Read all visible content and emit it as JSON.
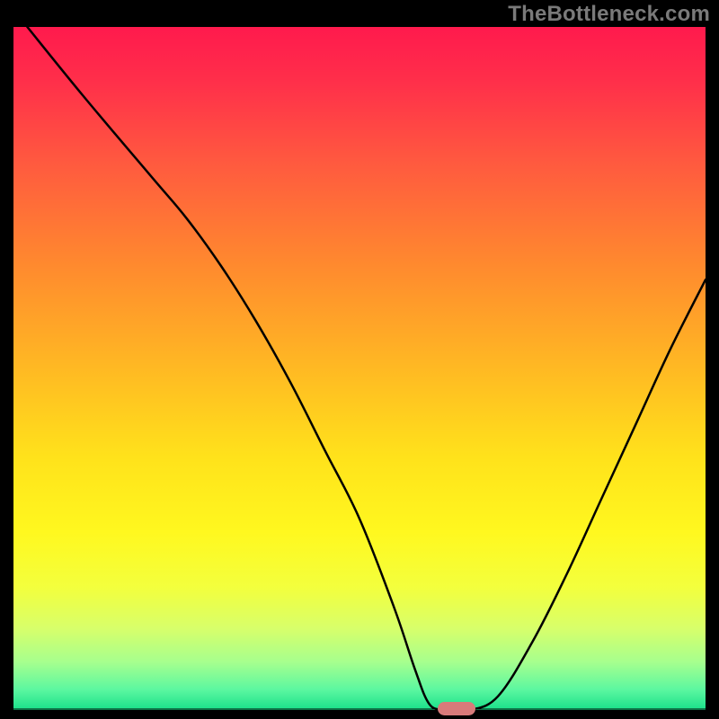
{
  "watermark": "TheBottleneck.com",
  "colors": {
    "frame": "#000000",
    "watermark": "#7a7a7a",
    "curve": "#000000",
    "marker": "#d87a7a",
    "gradient_stops": [
      {
        "offset": 0.0,
        "color": "#ff1a4d"
      },
      {
        "offset": 0.08,
        "color": "#ff2f4a"
      },
      {
        "offset": 0.2,
        "color": "#ff5a3f"
      },
      {
        "offset": 0.35,
        "color": "#ff8a2e"
      },
      {
        "offset": 0.5,
        "color": "#ffb923"
      },
      {
        "offset": 0.63,
        "color": "#ffe21b"
      },
      {
        "offset": 0.74,
        "color": "#fff81f"
      },
      {
        "offset": 0.82,
        "color": "#f3ff3d"
      },
      {
        "offset": 0.88,
        "color": "#d8ff6a"
      },
      {
        "offset": 0.93,
        "color": "#a6ff8e"
      },
      {
        "offset": 0.97,
        "color": "#5cf7a0"
      },
      {
        "offset": 1.0,
        "color": "#19e08a"
      }
    ]
  },
  "chart_data": {
    "type": "line",
    "title": "",
    "xlabel": "",
    "ylabel": "",
    "xlim": [
      0,
      100
    ],
    "ylim": [
      0,
      100
    ],
    "grid": false,
    "note": "V-shaped bottleneck curve on red→green vertical gradient. Values estimated from pixels: y=0 is bottom (optimal), y=100 is top (severe mismatch).",
    "x": [
      2,
      10,
      20,
      25,
      30,
      35,
      40,
      45,
      50,
      55,
      58,
      60,
      62,
      64,
      66,
      70,
      75,
      80,
      85,
      90,
      95,
      100
    ],
    "y": [
      100,
      90,
      78,
      72,
      65,
      57,
      48,
      38,
      28,
      15,
      6,
      1,
      0,
      0,
      0,
      2,
      10,
      20,
      31,
      42,
      53,
      63
    ],
    "optimal_marker": {
      "x": 64,
      "y": 0
    }
  }
}
